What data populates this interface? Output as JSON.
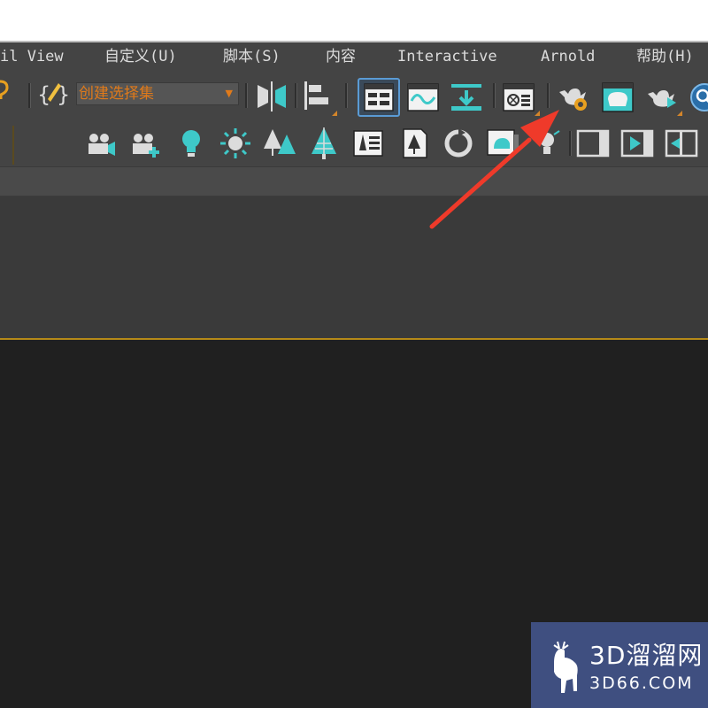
{
  "menubar": {
    "items": [
      {
        "label": "il View"
      },
      {
        "label": "自定义(U)"
      },
      {
        "label": "脚本(S)"
      },
      {
        "label": "内容"
      },
      {
        "label": "Interactive"
      },
      {
        "label": "Arnold"
      },
      {
        "label": "帮助(H)"
      }
    ]
  },
  "toolbar": {
    "selection_set_value": "创建选择集",
    "dropdown_arrow": "▼"
  },
  "icons": {
    "toolbar1": [
      "help-partial-icon",
      "curly-braces-edit-icon",
      "mirror-icon",
      "align-icon",
      "scene-explorer-icon",
      "curve-editor-icon",
      "schematic-view-icon",
      "material-editor-icon",
      "render-setup-icon",
      "rendered-frame-window-icon",
      "render-production-icon",
      "search-icon"
    ],
    "toolbar2": [
      "camera-icon",
      "camera-add-icon",
      "light-bulb-icon",
      "sun-icon",
      "trees-icon",
      "tree-icon",
      "library-icon",
      "tree-document-icon",
      "rotate-icon",
      "viewport-icon",
      "bulb-icon",
      "panel-icon",
      "play-panel-icon",
      "add-panel-icon"
    ]
  },
  "colors": {
    "accent_teal": "#3ec9c9",
    "accent_orange": "#e07a1a",
    "active_blue": "#5a9bd5",
    "arrow_red": "#ef3a2a",
    "viewport_border": "#b58a18"
  },
  "watermark": {
    "cn": "3D溜溜网",
    "en": "3D66.COM"
  }
}
